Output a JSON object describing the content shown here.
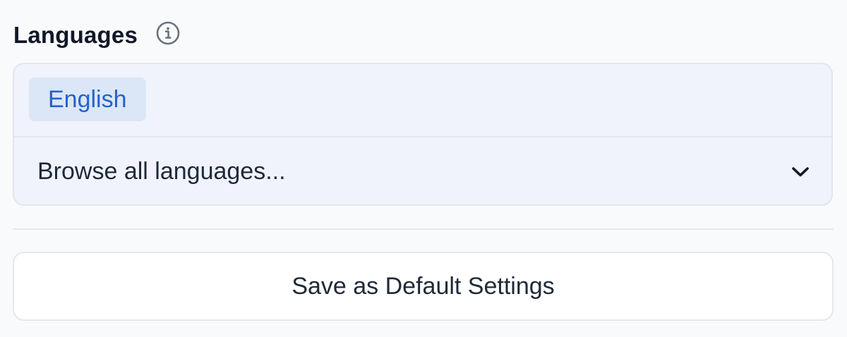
{
  "languages_section": {
    "title": "Languages",
    "info_icon": "info-circle-icon",
    "selected_languages": [
      "English"
    ],
    "browse_placeholder": "Browse all languages...",
    "dropdown_icon": "chevron-down-icon"
  },
  "actions": {
    "save_default_label": "Save as Default Settings"
  },
  "colors": {
    "tag_background": "#dbe6f7",
    "tag_text": "#2563c9",
    "panel_background": "#f0f3fc"
  }
}
